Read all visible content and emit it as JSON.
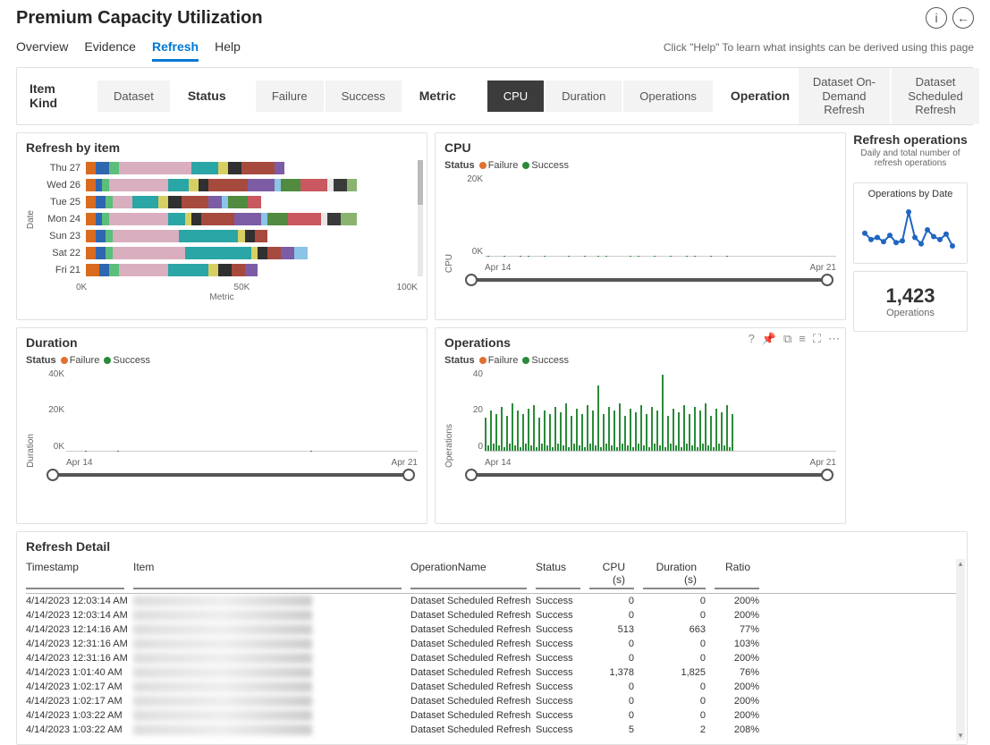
{
  "title": "Premium Capacity Utilization",
  "tabs": [
    "Overview",
    "Evidence",
    "Refresh",
    "Help"
  ],
  "active_tab": "Refresh",
  "help_line": "Click \"Help\" To learn what insights can be derived using this page",
  "slicers": {
    "item_kind": {
      "label": "Item Kind",
      "options": [
        "Dataset"
      ]
    },
    "status": {
      "label": "Status",
      "options": [
        "Failure",
        "Success"
      ]
    },
    "metric": {
      "label": "Metric",
      "options": [
        "CPU",
        "Duration",
        "Operations"
      ],
      "selected": "CPU"
    },
    "operation": {
      "label": "Operation",
      "options": [
        "Dataset On-Demand Refresh",
        "Dataset Scheduled Refresh"
      ]
    }
  },
  "refresh_by_item": {
    "title": "Refresh by item",
    "y_title": "Date",
    "x_title": "Metric",
    "x_ticks": [
      "0K",
      "50K",
      "100K"
    ]
  },
  "cpu_card": {
    "title": "CPU",
    "legend_label": "Status",
    "failure_label": "Failure",
    "success_label": "Success",
    "y_title": "CPU",
    "y_ticks": [
      "20K",
      "0K"
    ],
    "x_labels": [
      "Apr 14",
      "Apr 21"
    ]
  },
  "duration_card": {
    "title": "Duration",
    "legend_label": "Status",
    "failure_label": "Failure",
    "success_label": "Success",
    "y_title": "Duration",
    "y_ticks": [
      "40K",
      "20K",
      "0K"
    ],
    "x_labels": [
      "Apr 14",
      "Apr 21"
    ]
  },
  "ops_card": {
    "title": "Operations",
    "legend_label": "Status",
    "failure_label": "Failure",
    "success_label": "Success",
    "y_title": "Operations",
    "y_ticks": [
      "40",
      "20",
      "0"
    ],
    "x_labels": [
      "Apr 14",
      "Apr 21"
    ]
  },
  "side": {
    "title": "Refresh operations",
    "subtitle": "Daily and total number of refresh operations",
    "spark_title": "Operations by Date",
    "kpi_value": "1,423",
    "kpi_label": "Operations"
  },
  "detail": {
    "title": "Refresh Detail",
    "columns": [
      "Timestamp",
      "Item",
      "OperationName",
      "Status",
      "CPU (s)",
      "Duration (s)",
      "Ratio"
    ],
    "rows": [
      {
        "ts": "4/14/2023 12:03:14 AM",
        "op": "Dataset Scheduled Refresh",
        "status": "Success",
        "cpu": "0",
        "dur": "0",
        "ratio": "200%"
      },
      {
        "ts": "4/14/2023 12:03:14 AM",
        "op": "Dataset Scheduled Refresh",
        "status": "Success",
        "cpu": "0",
        "dur": "0",
        "ratio": "200%"
      },
      {
        "ts": "4/14/2023 12:14:16 AM",
        "op": "Dataset Scheduled Refresh",
        "status": "Success",
        "cpu": "513",
        "dur": "663",
        "ratio": "77%"
      },
      {
        "ts": "4/14/2023 12:31:16 AM",
        "op": "Dataset Scheduled Refresh",
        "status": "Success",
        "cpu": "0",
        "dur": "0",
        "ratio": "103%"
      },
      {
        "ts": "4/14/2023 12:31:16 AM",
        "op": "Dataset Scheduled Refresh",
        "status": "Success",
        "cpu": "0",
        "dur": "0",
        "ratio": "200%"
      },
      {
        "ts": "4/14/2023 1:01:40 AM",
        "op": "Dataset Scheduled Refresh",
        "status": "Success",
        "cpu": "1,378",
        "dur": "1,825",
        "ratio": "76%"
      },
      {
        "ts": "4/14/2023 1:02:17 AM",
        "op": "Dataset Scheduled Refresh",
        "status": "Success",
        "cpu": "0",
        "dur": "0",
        "ratio": "200%"
      },
      {
        "ts": "4/14/2023 1:02:17 AM",
        "op": "Dataset Scheduled Refresh",
        "status": "Success",
        "cpu": "0",
        "dur": "0",
        "ratio": "200%"
      },
      {
        "ts": "4/14/2023 1:03:22 AM",
        "op": "Dataset Scheduled Refresh",
        "status": "Success",
        "cpu": "0",
        "dur": "0",
        "ratio": "200%"
      },
      {
        "ts": "4/14/2023 1:03:22 AM",
        "op": "Dataset Scheduled Refresh",
        "status": "Success",
        "cpu": "5",
        "dur": "2",
        "ratio": "208%"
      }
    ]
  },
  "chart_data": {
    "refresh_by_item": {
      "type": "bar",
      "orientation": "horizontal-stacked",
      "x_range": [
        0,
        100000
      ],
      "categories": [
        "Thu 27",
        "Wed 26",
        "Tue 25",
        "Mon 24",
        "Sun 23",
        "Sat 22",
        "Fri 21"
      ],
      "segments_pct": [
        [
          3,
          4,
          3,
          22,
          8,
          3,
          4,
          10,
          3
        ],
        [
          3,
          2,
          2,
          18,
          6,
          3,
          3,
          12,
          8,
          2,
          6,
          8,
          2,
          4,
          3
        ],
        [
          3,
          3,
          2,
          6,
          8,
          3,
          4,
          8,
          4,
          2,
          6,
          4
        ],
        [
          3,
          2,
          2,
          18,
          5,
          2,
          3,
          10,
          8,
          2,
          6,
          10,
          2,
          4,
          5
        ],
        [
          3,
          3,
          2,
          20,
          18,
          2,
          3,
          4
        ],
        [
          3,
          3,
          2,
          22,
          20,
          2,
          3,
          4,
          4,
          4
        ],
        [
          4,
          3,
          3,
          15,
          12,
          3,
          4,
          4,
          4
        ]
      ],
      "palette": [
        "#d96b1f",
        "#2f66b0",
        "#5abf7a",
        "#d9aebf",
        "#2aa6a6",
        "#d8cf63",
        "#303030",
        "#a74a3e",
        "#7d5ca6",
        "#8bc4e6",
        "#508b3f",
        "#c95860",
        "#e7e7e7",
        "#3a3a3a",
        "#8ab36f"
      ]
    },
    "cpu": {
      "type": "bar",
      "ylim": [
        0,
        25000
      ],
      "x_labels": [
        "Apr 14",
        "Apr 21"
      ],
      "series": [
        {
          "name": "Success",
          "values": [
            5,
            23,
            4,
            3,
            18,
            2,
            2,
            22,
            3,
            4,
            20,
            6,
            3,
            25,
            2,
            4,
            23,
            3,
            3,
            21,
            2,
            5,
            24,
            3,
            3,
            18,
            4,
            2,
            20,
            3,
            4,
            23,
            2,
            3,
            21,
            4,
            3,
            24,
            2,
            4,
            19,
            3,
            22,
            3,
            2,
            23,
            5,
            3,
            20,
            4,
            3,
            21,
            2,
            4,
            24,
            3,
            2,
            22,
            3,
            4,
            20,
            2,
            3,
            23,
            4,
            2,
            21,
            3,
            4,
            24,
            2,
            3,
            19,
            5,
            3,
            22,
            2,
            4,
            24,
            3,
            3,
            20,
            4,
            2,
            23,
            3,
            4,
            21,
            2,
            3,
            24,
            4
          ]
        },
        {
          "name": "Failure",
          "values": []
        }
      ]
    },
    "duration": {
      "type": "bar",
      "ylim": [
        0,
        40000
      ],
      "x_labels": [
        "Apr 14",
        "Apr 21"
      ],
      "series": [
        {
          "name": "Success",
          "values": [
            10,
            3,
            2,
            4,
            28,
            2,
            3,
            38,
            4,
            2,
            30,
            3,
            2,
            22,
            3,
            4,
            26,
            2,
            3,
            40,
            4,
            2,
            24,
            3,
            4,
            28,
            2,
            3,
            32,
            4,
            2,
            23,
            3,
            4,
            30,
            2,
            3,
            26,
            4,
            2,
            7,
            3,
            4,
            28,
            2,
            3,
            24,
            4,
            2,
            30,
            3,
            4,
            26,
            2,
            3,
            34,
            4,
            2,
            28,
            3,
            4,
            22,
            2,
            3,
            30,
            4,
            2,
            26,
            3,
            4,
            24,
            2,
            3,
            32,
            4,
            2,
            28,
            3,
            4,
            25,
            2,
            3,
            30,
            4,
            2,
            26,
            3,
            4,
            24,
            2,
            3,
            38
          ]
        },
        {
          "name": "Failure",
          "values": []
        }
      ]
    },
    "operations": {
      "type": "bar",
      "ylim": [
        0,
        45
      ],
      "x_labels": [
        "Apr 14",
        "Apr 21"
      ],
      "series": [
        {
          "name": "Success",
          "values": [
            18,
            3,
            22,
            4,
            20,
            3,
            24,
            2,
            19,
            4,
            26,
            3,
            22,
            2,
            20,
            4,
            23,
            3,
            25,
            2,
            18,
            4,
            22,
            3,
            20,
            2,
            24,
            4,
            21,
            3,
            26,
            2,
            19,
            4,
            23,
            3,
            20,
            2,
            25,
            4,
            22,
            3,
            36,
            2,
            20,
            4,
            24,
            3,
            22,
            2,
            26,
            4,
            19,
            3,
            23,
            2,
            21,
            4,
            25,
            3,
            20,
            2,
            24,
            4,
            22,
            3,
            42,
            2,
            19,
            4,
            23,
            3,
            21,
            2,
            25,
            4,
            20,
            3,
            24,
            2,
            22,
            4,
            26,
            3,
            19,
            2,
            23,
            4,
            21,
            3,
            25,
            2,
            20
          ]
        },
        {
          "name": "Failure",
          "values": []
        }
      ]
    },
    "operations_by_date": {
      "type": "line",
      "values": [
        110,
        95,
        100,
        90,
        105,
        88,
        92,
        160,
        100,
        85,
        118,
        102,
        95,
        108,
        80
      ]
    }
  }
}
